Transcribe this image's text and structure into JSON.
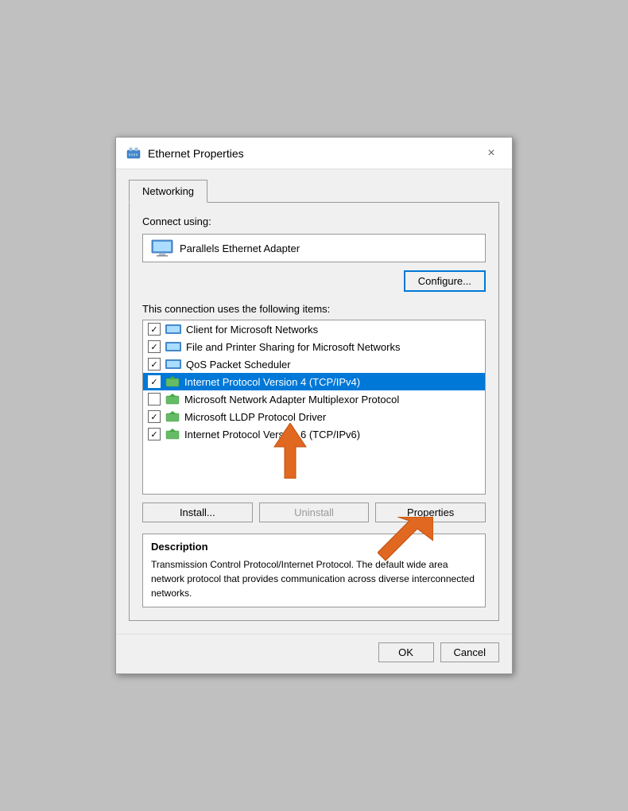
{
  "window": {
    "title": "Ethernet Properties",
    "close_label": "×"
  },
  "tabs": [
    {
      "id": "networking",
      "label": "Networking",
      "active": true
    }
  ],
  "connect_using_label": "Connect using:",
  "adapter": {
    "name": "Parallels Ethernet Adapter"
  },
  "configure_button": "Configure...",
  "items_label": "This connection uses the following items:",
  "items": [
    {
      "id": "client",
      "checked": true,
      "label": "Client for Microsoft Networks",
      "selected": false,
      "icon_type": "network"
    },
    {
      "id": "sharing",
      "checked": true,
      "label": "File and Printer Sharing for Microsoft Networks",
      "selected": false,
      "icon_type": "network"
    },
    {
      "id": "qos",
      "checked": true,
      "label": "QoS Packet Scheduler",
      "selected": false,
      "icon_type": "network"
    },
    {
      "id": "ipv4",
      "checked": true,
      "label": "Internet Protocol Version 4 (TCP/IPv4)",
      "selected": true,
      "icon_type": "green"
    },
    {
      "id": "multiplexor",
      "checked": false,
      "label": "Microsoft Network Adapter Multiplexor Protocol",
      "selected": false,
      "icon_type": "green"
    },
    {
      "id": "lldp",
      "checked": true,
      "label": "Microsoft LLDP Protocol Driver",
      "selected": false,
      "icon_type": "green"
    },
    {
      "id": "ipv6",
      "checked": true,
      "label": "Internet Protocol Version 6 (TCP/IPv6)",
      "selected": false,
      "icon_type": "green"
    }
  ],
  "buttons": {
    "install": "Install...",
    "uninstall": "Uninstall",
    "properties": "Properties"
  },
  "description": {
    "title": "Description",
    "text": "Transmission Control Protocol/Internet Protocol. The default wide area network protocol that provides communication across diverse interconnected networks."
  },
  "footer": {
    "ok": "OK",
    "cancel": "Cancel"
  },
  "colors": {
    "selected_bg": "#0078d7",
    "configure_border": "#0078d7"
  }
}
